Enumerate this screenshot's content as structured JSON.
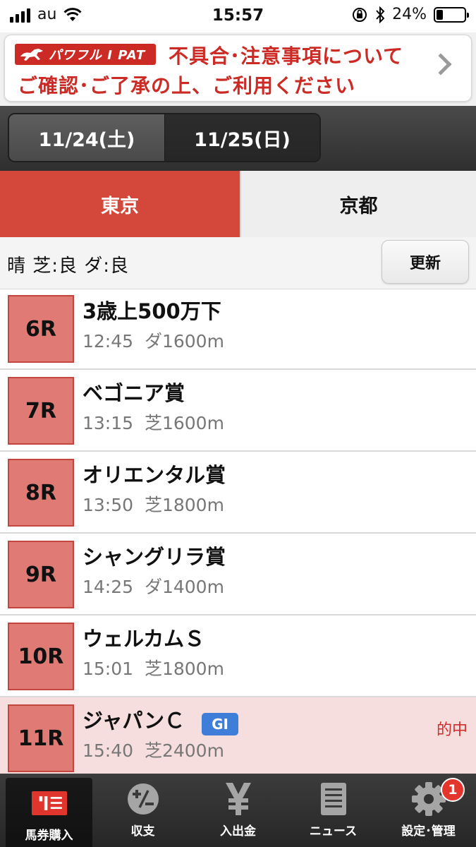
{
  "status_bar": {
    "carrier": "au",
    "time": "15:57",
    "battery_percent": "24%",
    "battery_level": 0.24
  },
  "banner": {
    "logo_text": "パワフル I PAT",
    "line1": "不具合･注意事項について",
    "line2": "ご確認･ご了承の上、ご利用ください"
  },
  "dates": [
    {
      "label": "11/24(土)",
      "selected": false
    },
    {
      "label": "11/25(日)",
      "selected": true
    }
  ],
  "venues": [
    {
      "label": "東京",
      "selected": true
    },
    {
      "label": "京都",
      "selected": false
    }
  ],
  "conditions": {
    "text": "晴 芝:良 ダ:良",
    "refresh_label": "更新"
  },
  "races": [
    {
      "number": "6R",
      "name": "3歳上500万下",
      "time": "12:45",
      "course": "ダ1600m",
      "grade": "",
      "result": ""
    },
    {
      "number": "7R",
      "name": "ベゴニア賞",
      "time": "13:15",
      "course": "芝1600m",
      "grade": "",
      "result": ""
    },
    {
      "number": "8R",
      "name": "オリエンタル賞",
      "time": "13:50",
      "course": "芝1800m",
      "grade": "",
      "result": ""
    },
    {
      "number": "9R",
      "name": "シャングリラ賞",
      "time": "14:25",
      "course": "ダ1400m",
      "grade": "",
      "result": ""
    },
    {
      "number": "10R",
      "name": "ウェルカムＳ",
      "time": "15:01",
      "course": "芝1800m",
      "grade": "",
      "result": ""
    },
    {
      "number": "11R",
      "name": "ジャパンＣ",
      "time": "15:40",
      "course": "芝2400m",
      "grade": "GI",
      "result": "的中"
    }
  ],
  "tabbar": [
    {
      "label": "馬券購入",
      "icon": "ticket-icon"
    },
    {
      "label": "収支",
      "icon": "balance-icon"
    },
    {
      "label": "入出金",
      "icon": "yen-icon"
    },
    {
      "label": "ニュース",
      "icon": "news-icon"
    },
    {
      "label": "設定･管理",
      "icon": "gear-icon",
      "badge": "1"
    }
  ],
  "colors": {
    "accent_red": "#d4483c",
    "race_badge": "#e07a74",
    "highlight_row": "#f7dede",
    "grade_blue": "#3f7ed8",
    "result_red": "#d12c2c"
  }
}
